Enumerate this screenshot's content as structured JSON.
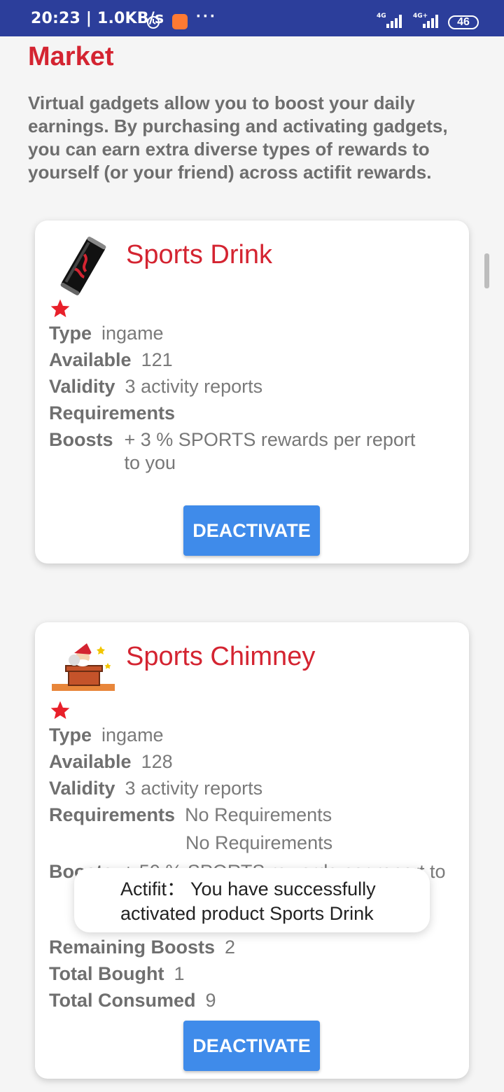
{
  "status_bar": {
    "time_speed": "20:23 | 1.0KB/s",
    "dots": "···",
    "battery": "46",
    "net1": "4G",
    "net2": "4G+"
  },
  "page": {
    "title": "Market",
    "intro": "Virtual gadgets allow you to boost your daily earnings. By purchasing and activating gadgets, you can earn extra diverse types of rewards to yourself (or your friend) across actifit rewards."
  },
  "cards": [
    {
      "title": "Sports Drink",
      "image_icon": "energy-drink-can-icon",
      "rows": {
        "type_label": "Type",
        "type_value": "ingame",
        "available_label": "Available",
        "available_value": "121",
        "validity_label": "Validity",
        "validity_value": "3 activity reports",
        "requirements_label": "Requirements",
        "requirements_value": "",
        "boosts_label": "Boosts",
        "boosts_value": "+ 3 % SPORTS rewards per report to you"
      },
      "button": "DEACTIVATE"
    },
    {
      "title": "Sports Chimney",
      "image_icon": "santa-chimney-icon",
      "rows": {
        "type_label": "Type",
        "type_value": "ingame",
        "available_label": "Available",
        "available_value": "128",
        "validity_label": "Validity",
        "validity_value": "3 activity reports",
        "requirements_label": "Requirements",
        "requirements_value": "No Requirements",
        "requirements_value_2": "No Requirements",
        "boosts_label": "Boosts",
        "boosts_value": "+ 50 % SPORTS rewards per report to",
        "remaining_label": "Remaining Boosts",
        "remaining_value": "2",
        "bought_label": "Total Bought",
        "bought_value": "1",
        "consumed_label": "Total Consumed",
        "consumed_value": "9"
      },
      "button": "DEACTIVATE"
    }
  ],
  "toast": {
    "text": "Actifit： You have successfully activated product Sports Drink"
  },
  "colors": {
    "accent_red": "#d42431",
    "button_blue": "#3f8bea",
    "statusbar": "#2c3e9b"
  }
}
